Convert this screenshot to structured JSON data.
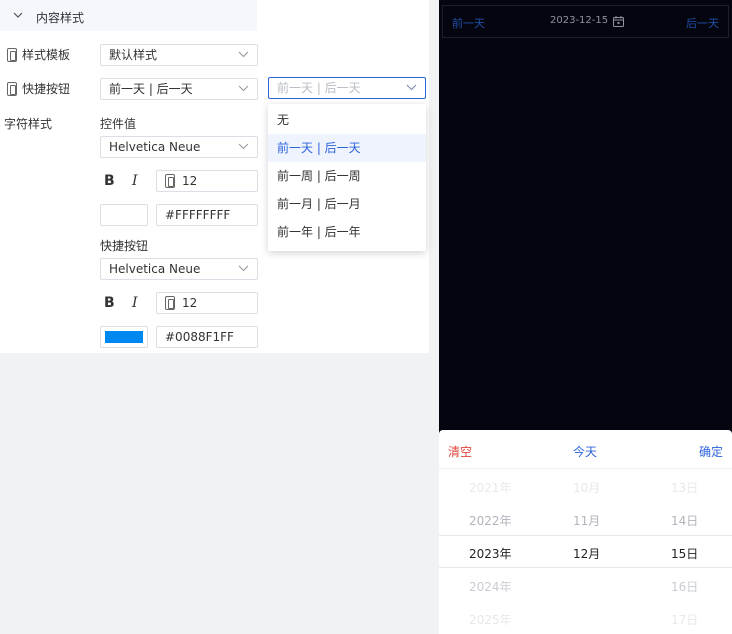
{
  "panel": {
    "section_title": "内容样式",
    "style_template": {
      "label": "样式模板",
      "value": "默认样式"
    },
    "shortcut_button": {
      "label": "快捷按钮",
      "value": "前一天 | 后一天",
      "active_value": "前一天 | 后一天"
    },
    "char_style": {
      "label": "字符样式",
      "control_value": {
        "label": "控件值",
        "font": "Helvetica Neue",
        "bold": "B",
        "italic": "I",
        "size": "12",
        "color": "#FFFFFFFF",
        "swatch": "#FFFFFF"
      },
      "shortcut": {
        "label": "快捷按钮",
        "font": "Helvetica Neue",
        "bold": "B",
        "italic": "I",
        "size": "12",
        "color": "#0088F1FF",
        "swatch": "#0088F1"
      }
    }
  },
  "dropdown": {
    "options": [
      "无",
      "前一天 | 后一天",
      "前一周 | 后一周",
      "前一月 | 后一月",
      "前一年 | 后一年"
    ],
    "selected_index": 1
  },
  "preview": {
    "prev_label": "前一天",
    "date": "2023-12-15",
    "next_label": "后一天",
    "picker": {
      "clear": "清空",
      "today": "今天",
      "confirm": "确定",
      "years": [
        "2021年",
        "2022年",
        "2023年",
        "2024年",
        "2025年"
      ],
      "months": [
        "10月",
        "11月",
        "12月"
      ],
      "days": [
        "13日",
        "14日",
        "15日",
        "16日",
        "17日"
      ]
    }
  },
  "colors": {
    "accent": "#2D64DC",
    "danger": "#E0443A",
    "preview_bg": "#05050F"
  }
}
